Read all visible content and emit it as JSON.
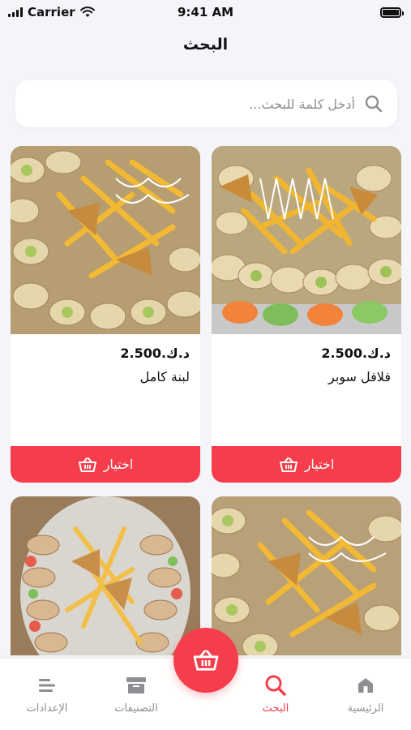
{
  "status_bar": {
    "carrier": "Carrier",
    "time": "9:41 AM"
  },
  "header": {
    "title": "البحث"
  },
  "search": {
    "placeholder": "أدخل كلمة للبحث..."
  },
  "products": [
    {
      "price": "د.ك.2.500",
      "name": "فلافل سوبر",
      "button": "اختيار"
    },
    {
      "price": "د.ك.2.500",
      "name": "لبنة كامل",
      "button": "اختيار"
    },
    {
      "price": "",
      "name": "",
      "button": ""
    },
    {
      "price": "",
      "name": "",
      "button": ""
    }
  ],
  "tabs": [
    {
      "label": "الرئيسية",
      "icon": "home-icon"
    },
    {
      "label": "البحث",
      "icon": "search-icon"
    },
    {
      "label": "التصنيفات",
      "icon": "categories-icon"
    },
    {
      "label": "الإعدادات",
      "icon": "settings-icon"
    }
  ],
  "colors": {
    "accent": "#f53d4b",
    "inactive": "#8e8e93",
    "background": "#f4f5f9"
  }
}
